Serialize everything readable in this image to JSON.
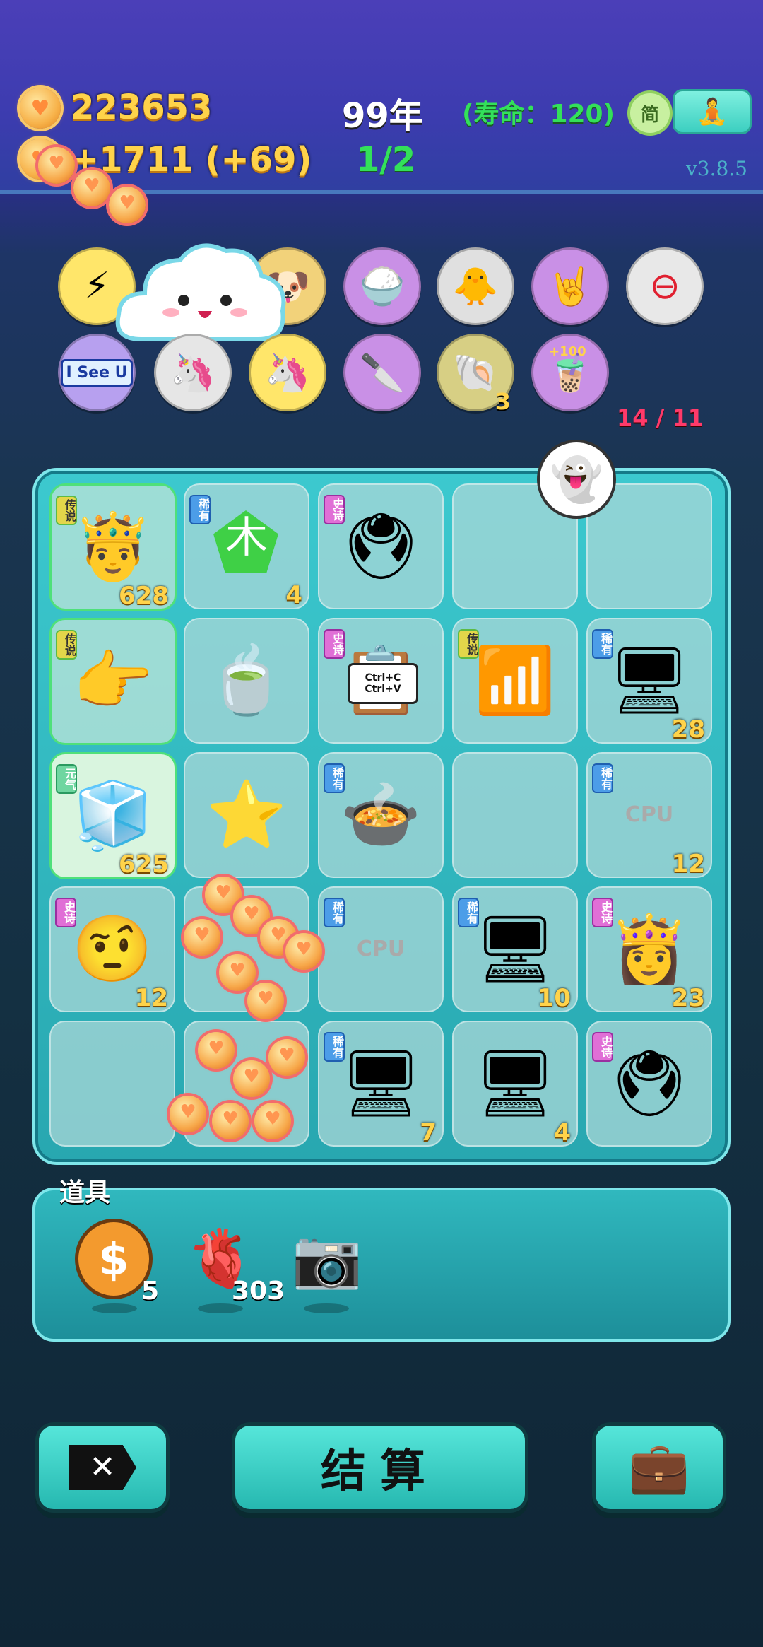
{
  "header": {
    "coins": "223653",
    "year": "99年",
    "lifespan": "(寿命：120)",
    "income": "+1711 (+69)",
    "round": "1/2",
    "simplified_btn": "简",
    "version": "v3.8.5"
  },
  "powerups": {
    "counter": "14 / 11",
    "row1": [
      {
        "icon": "lightning-icon",
        "glyph": "⚡"
      },
      {
        "icon": "cloud-icon",
        "glyph": "☁"
      },
      {
        "icon": "dog-icon",
        "glyph": "🐶"
      },
      {
        "icon": "bowls-icon",
        "glyph": "🍚"
      },
      {
        "icon": "chick-icon",
        "glyph": "🐥"
      },
      {
        "icon": "rock-hand-icon",
        "glyph": "🤘"
      },
      {
        "icon": "minus-icon",
        "glyph": "⊖"
      }
    ],
    "row2": [
      {
        "icon": "i-see-u-icon",
        "label": "I See U"
      },
      {
        "icon": "unicorn-twins-icon",
        "glyph": "🦄"
      },
      {
        "icon": "unicorn-icon",
        "glyph": "🦄"
      },
      {
        "icon": "cleaver-icon",
        "glyph": "🔪"
      },
      {
        "icon": "shell-icon",
        "glyph": "🐚",
        "count": "3"
      },
      {
        "icon": "bubble-tea-icon",
        "glyph": "🧋",
        "badge": "+100"
      }
    ]
  },
  "board": {
    "cells": [
      {
        "tag": "传说",
        "tagType": "legend",
        "icon": "king-sunglasses-icon",
        "glyph": "🤴",
        "count": "628",
        "style": "legend"
      },
      {
        "tag": "稀有",
        "tagType": "rare",
        "icon": "wood-element-icon",
        "glyph": "木",
        "count": "4"
      },
      {
        "tag": "史诗",
        "tagType": "epic",
        "icon": "graphics-card-icon",
        "glyph": "🖲",
        "count": ""
      },
      {
        "tag": "",
        "tagType": "",
        "icon": "empty",
        "glyph": "",
        "count": ""
      },
      {
        "tag": "",
        "tagType": "",
        "icon": "empty",
        "glyph": "",
        "count": ""
      },
      {
        "tag": "传说",
        "tagType": "legend",
        "icon": "pointing-hand-icon",
        "glyph": "👉",
        "count": "",
        "style": "legend"
      },
      {
        "tag": "",
        "tagType": "",
        "icon": "tea-bag-icon",
        "glyph": "🍵",
        "count": ""
      },
      {
        "tag": "史诗",
        "tagType": "epic",
        "icon": "copy-paste-icon",
        "glyph": "📋",
        "count": "",
        "caption": "Ctrl+C Ctrl+V"
      },
      {
        "tag": "传说",
        "tagType": "legend",
        "icon": "wifi-icon",
        "glyph": "📶",
        "count": ""
      },
      {
        "tag": "稀有",
        "tagType": "rare",
        "icon": "server-tower-icon",
        "glyph": "🖥",
        "count": "28"
      },
      {
        "tag": "元气",
        "tagType": "yuan",
        "icon": "fridge-icon",
        "glyph": "🧊",
        "count": "625",
        "style": "selected"
      },
      {
        "tag": "",
        "tagType": "",
        "icon": "star-icon",
        "glyph": "⭐",
        "count": ""
      },
      {
        "tag": "稀有",
        "tagType": "rare",
        "icon": "pressure-cooker-icon",
        "glyph": "🍲",
        "count": ""
      },
      {
        "tag": "",
        "tagType": "",
        "icon": "empty",
        "glyph": "",
        "count": ""
      },
      {
        "tag": "稀有",
        "tagType": "rare",
        "icon": "cpu-chip-icon",
        "glyph": "CPU",
        "count": "12"
      },
      {
        "tag": "史诗",
        "tagType": "epic",
        "icon": "confused-man-icon",
        "glyph": "🤨",
        "count": "12"
      },
      {
        "tag": "",
        "tagType": "",
        "icon": "empty",
        "glyph": "",
        "count": ""
      },
      {
        "tag": "稀有",
        "tagType": "rare",
        "icon": "cpu-chip-icon",
        "glyph": "CPU",
        "count": ""
      },
      {
        "tag": "稀有",
        "tagType": "rare",
        "icon": "server-tower-icon",
        "glyph": "🖥",
        "count": "10"
      },
      {
        "tag": "史诗",
        "tagType": "epic",
        "icon": "crowned-girl-icon",
        "glyph": "👸",
        "count": "23"
      },
      {
        "tag": "",
        "tagType": "",
        "icon": "empty",
        "glyph": "",
        "count": ""
      },
      {
        "tag": "",
        "tagType": "",
        "icon": "empty",
        "glyph": "",
        "count": ""
      },
      {
        "tag": "稀有",
        "tagType": "rare",
        "icon": "server-tower-icon",
        "glyph": "🖥",
        "count": "7"
      },
      {
        "tag": "",
        "tagType": "",
        "icon": "smiling-monitor-icon",
        "glyph": "🖥",
        "count": "4"
      },
      {
        "tag": "史诗",
        "tagType": "epic",
        "icon": "graphics-card-icon",
        "glyph": "🖲",
        "count": ""
      }
    ]
  },
  "props": {
    "title": "道具",
    "items": [
      {
        "icon": "dollar-coin-icon",
        "glyph": "$",
        "count": "5"
      },
      {
        "icon": "liver-icon",
        "glyph": "🫀",
        "count": "303"
      },
      {
        "icon": "camera-icon",
        "glyph": "📷",
        "count": ""
      }
    ]
  },
  "footer": {
    "settle_label": "结算"
  },
  "colors": {
    "gold": "#ffd34a",
    "board": "#3cc9cf",
    "lifespan": "#33e05a",
    "counter": "#ff3a6a"
  }
}
